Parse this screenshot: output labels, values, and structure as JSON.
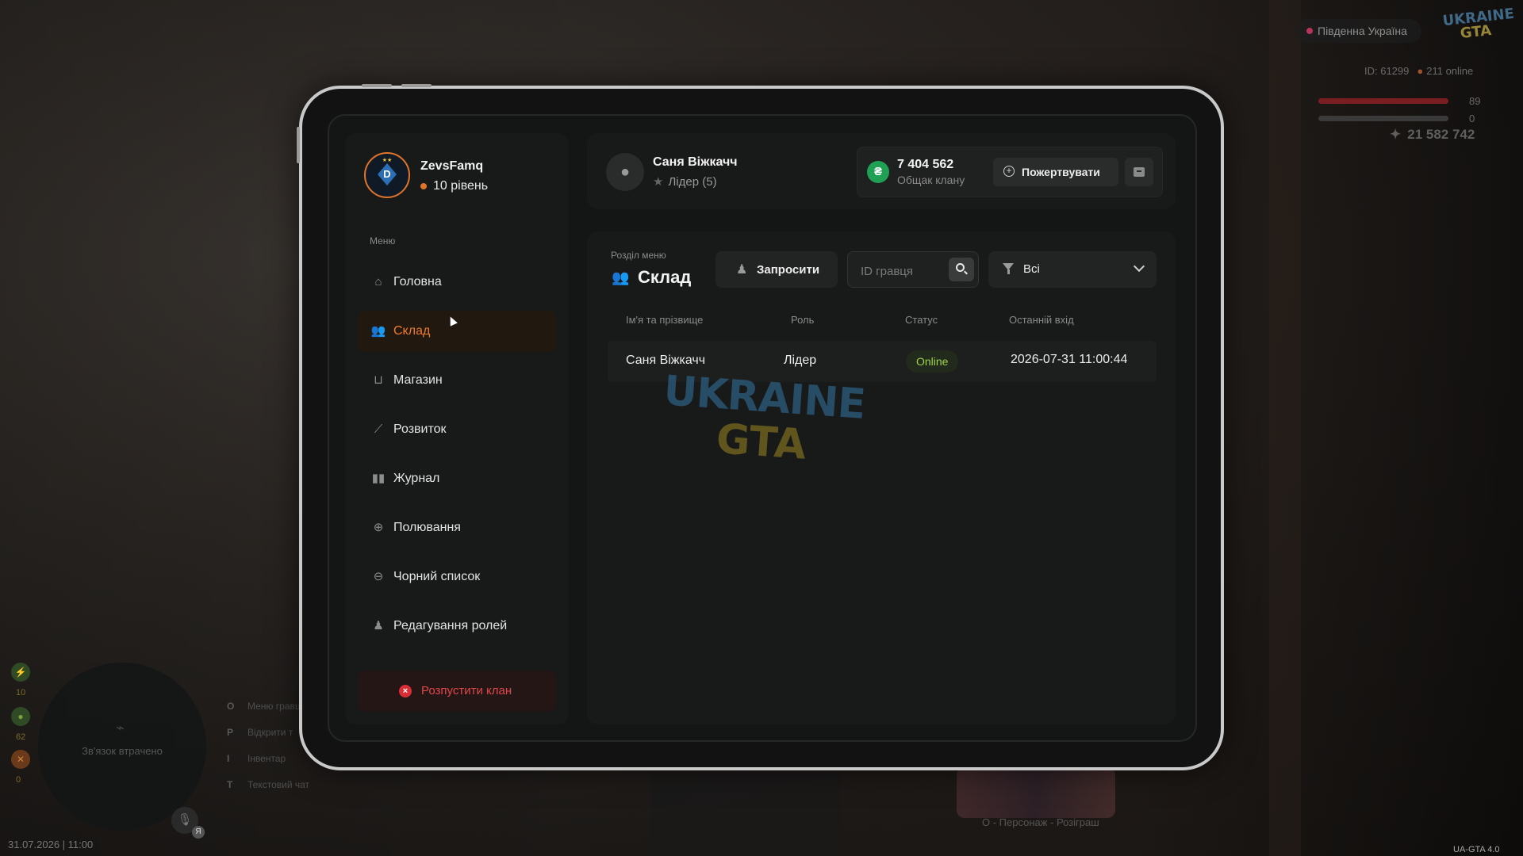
{
  "hud": {
    "server": "Південна Україна",
    "logo_top": "UKRAINE",
    "logo_bottom": "GTA",
    "player_id": "ID: 61299",
    "online": "211 online",
    "health": "89",
    "armor": "0",
    "money": "21 582 742",
    "status_values": [
      "10",
      "62",
      "0"
    ],
    "map_status": "Зв'язок втрачено",
    "mic_badge": "Я",
    "hints": [
      {
        "key": "O",
        "label": "Меню гравця"
      },
      {
        "key": "P",
        "label": "Відкрити т"
      },
      {
        "key": "I",
        "label": "Інвентар"
      },
      {
        "key": "T",
        "label": "Текстовий чат"
      }
    ],
    "date": "31.07.2026 | 11:00",
    "promo_hint": "O - Персонаж - Розіграш",
    "version": "UA-GTA 4.0"
  },
  "clan": {
    "name": "ZevsFamq",
    "level": "10 рівень",
    "avatar_letter": "D",
    "avatar_stars": "★★"
  },
  "sidebar": {
    "menu_label": "Меню",
    "items": [
      {
        "label": "Головна",
        "icon": "home-icon",
        "glyph": "⌂"
      },
      {
        "label": "Склад",
        "icon": "users-icon",
        "glyph": "👥"
      },
      {
        "label": "Магазин",
        "icon": "basket-icon",
        "glyph": "⊔"
      },
      {
        "label": "Розвиток",
        "icon": "chart-icon",
        "glyph": "⟋"
      },
      {
        "label": "Журнал",
        "icon": "book-icon",
        "glyph": "▮▮"
      },
      {
        "label": "Полювання",
        "icon": "crosshair-icon",
        "glyph": "⊕"
      },
      {
        "label": "Чорний список",
        "icon": "block-icon",
        "glyph": "⊖"
      },
      {
        "label": "Редагування ролей",
        "icon": "user-edit-icon",
        "glyph": "♟"
      }
    ],
    "active_index": 1,
    "disband_label": "Розпустити клан",
    "accent_color": "#f07a2a",
    "danger_color": "#e0474c"
  },
  "user": {
    "name": "Саня Віжкачч",
    "role": "Лідер (5)"
  },
  "bank": {
    "currency_symbol": "₴",
    "amount": "7 404 562",
    "label": "Общак клану",
    "donate_label": "Пожертвувати"
  },
  "section": {
    "label": "Розділ меню",
    "title": "Склад",
    "invite_label": "Запросити",
    "search_placeholder": "ID гравця",
    "filter_value": "Всі"
  },
  "table": {
    "headers": [
      "Ім'я та прізвище",
      "Роль",
      "Статус",
      "Останній вхід"
    ],
    "rows": [
      {
        "name": "Саня Віжкачч",
        "role": "Лідер",
        "status": "Online",
        "last_login": "2026-07-31 11:00:44"
      }
    ],
    "status_color": "#9ed24a"
  },
  "watermark": {
    "top": "UKRAINE",
    "bottom": "GTA"
  }
}
